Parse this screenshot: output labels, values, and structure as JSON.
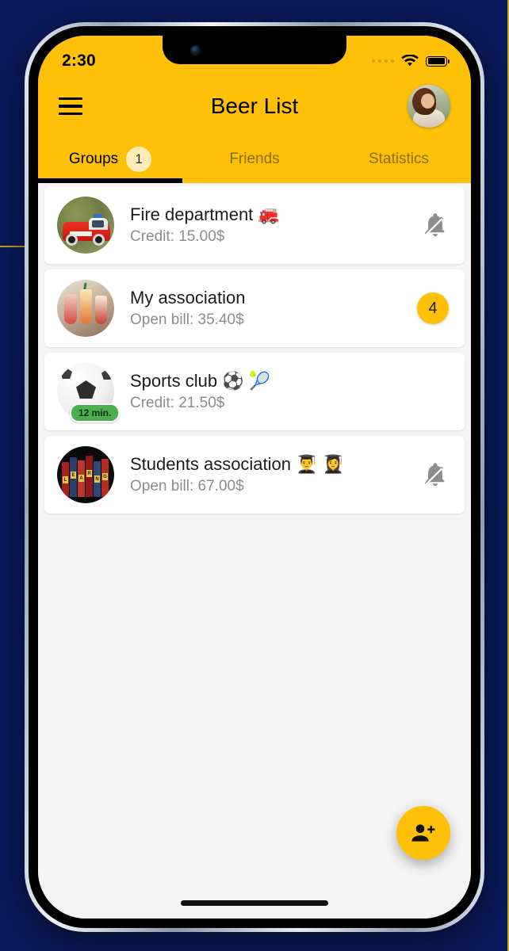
{
  "status_bar": {
    "time": "2:30",
    "signal_icon": "signal-dots-icon",
    "wifi_icon": "wifi-icon",
    "battery_icon": "battery-full-icon"
  },
  "app_bar": {
    "menu_icon": "hamburger-menu-icon",
    "title": "Beer List",
    "avatar_icon": "user-avatar"
  },
  "tabs": [
    {
      "label": "Groups",
      "badge": "1",
      "active": true
    },
    {
      "label": "Friends",
      "badge": "",
      "active": false
    },
    {
      "label": "Statistics",
      "badge": "",
      "active": false
    }
  ],
  "groups": [
    {
      "title": "Fire department 🚒",
      "subtitle": "Credit: 15.00$",
      "trailing_type": "bell-off",
      "trailing_value": "",
      "thumb_badge": ""
    },
    {
      "title": "My association",
      "subtitle": "Open bill: 35.40$",
      "trailing_type": "count",
      "trailing_value": "4",
      "thumb_badge": ""
    },
    {
      "title": "Sports club ⚽ 🎾",
      "subtitle": "Credit: 21.50$",
      "trailing_type": "none",
      "trailing_value": "",
      "thumb_badge": "12 min."
    },
    {
      "title": "Students association 👨‍🎓 👩‍🎓",
      "subtitle": "Open bill: 67.00$",
      "trailing_type": "bell-off",
      "trailing_value": "",
      "thumb_badge": ""
    }
  ],
  "fab": {
    "icon": "person-add-icon"
  },
  "colors": {
    "accent": "#FFC107",
    "page_background": "#0a1a5c",
    "list_background": "#f4f4f4",
    "card_background": "#ffffff",
    "badge_soft": "#ffecb8",
    "time_badge": "#4caf50",
    "subtitle_text": "#8c8c8c"
  }
}
